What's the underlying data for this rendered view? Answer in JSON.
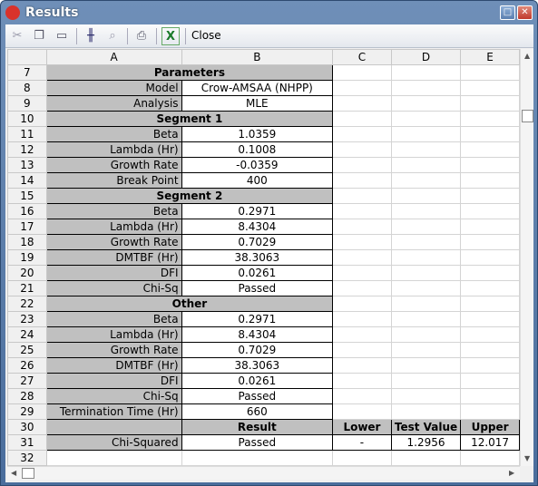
{
  "window": {
    "title": "Results",
    "logo": "RG"
  },
  "toolbar": {
    "icons": [
      "cut-icon",
      "copy-icon",
      "paste-icon",
      "freeze-icon",
      "zoom-icon",
      "print-icon",
      "excel-icon"
    ],
    "close_label": "Close"
  },
  "columns": [
    "A",
    "B",
    "C",
    "D",
    "E"
  ],
  "rows": [
    {
      "n": "7",
      "type": "sec",
      "a": "Parameters"
    },
    {
      "n": "8",
      "type": "kv",
      "a": "Model",
      "b": "Crow-AMSAA (NHPP)"
    },
    {
      "n": "9",
      "type": "kv",
      "a": "Analysis",
      "b": "MLE"
    },
    {
      "n": "10",
      "type": "sec",
      "a": "Segment 1"
    },
    {
      "n": "11",
      "type": "kv",
      "a": "Beta",
      "b": "1.0359"
    },
    {
      "n": "12",
      "type": "kv",
      "a": "Lambda (Hr)",
      "b": "0.1008"
    },
    {
      "n": "13",
      "type": "kv",
      "a": "Growth Rate",
      "b": "-0.0359"
    },
    {
      "n": "14",
      "type": "kv",
      "a": "Break Point",
      "b": "400"
    },
    {
      "n": "15",
      "type": "sec",
      "a": "Segment 2"
    },
    {
      "n": "16",
      "type": "kv",
      "a": "Beta",
      "b": "0.2971"
    },
    {
      "n": "17",
      "type": "kv",
      "a": "Lambda (Hr)",
      "b": "8.4304"
    },
    {
      "n": "18",
      "type": "kv",
      "a": "Growth Rate",
      "b": "0.7029"
    },
    {
      "n": "19",
      "type": "kv",
      "a": "DMTBF (Hr)",
      "b": "38.3063"
    },
    {
      "n": "20",
      "type": "kv",
      "a": "DFI",
      "b": "0.0261"
    },
    {
      "n": "21",
      "type": "kv",
      "a": "Chi-Sq",
      "b": "Passed"
    },
    {
      "n": "22",
      "type": "sec",
      "a": "Other"
    },
    {
      "n": "23",
      "type": "kv",
      "a": "Beta",
      "b": "0.2971"
    },
    {
      "n": "24",
      "type": "kv",
      "a": "Lambda (Hr)",
      "b": "8.4304"
    },
    {
      "n": "25",
      "type": "kv",
      "a": "Growth Rate",
      "b": "0.7029"
    },
    {
      "n": "26",
      "type": "kv",
      "a": "DMTBF (Hr)",
      "b": "38.3063"
    },
    {
      "n": "27",
      "type": "kv",
      "a": "DFI",
      "b": "0.0261"
    },
    {
      "n": "28",
      "type": "kv",
      "a": "Chi-Sq",
      "b": "Passed"
    },
    {
      "n": "29",
      "type": "kv",
      "a": "Termination Time (Hr)",
      "b": "660"
    },
    {
      "n": "30",
      "type": "hdr",
      "a": "",
      "b": "Result",
      "c": "Lower",
      "d": "Test Value",
      "e": "Upper"
    },
    {
      "n": "31",
      "type": "res",
      "a": "Chi-Squared",
      "b": "Passed",
      "c": "-",
      "d": "1.2956",
      "e": "12.017"
    },
    {
      "n": "32",
      "type": "empty"
    }
  ]
}
